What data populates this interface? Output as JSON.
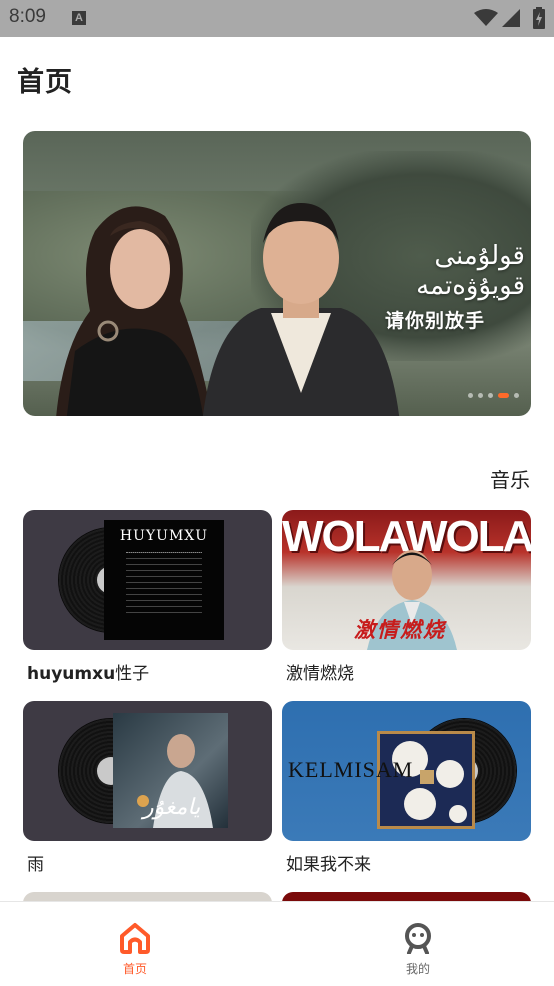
{
  "status_bar": {
    "time": "8:09",
    "notification_icon": "A"
  },
  "header": {
    "title": "首页"
  },
  "banner": {
    "uyghur_text": "قولۇمنى قويۇۋەتمە",
    "cn_text": "请你别放手",
    "dot_count": 5,
    "active_dot_index": 3
  },
  "music_section": {
    "title": "音乐",
    "items": [
      {
        "title_bold": "huyumxu",
        "title_rest": "性子",
        "cover_text": "HUYUMXU"
      },
      {
        "title": "激情燃烧",
        "cover_text": "WOLAWOLA",
        "cover_subtext": "激情燃烧"
      },
      {
        "title": "雨",
        "cover_text": "يامغۇر"
      },
      {
        "title": "如果我不来",
        "cover_text": "KELMISAM"
      }
    ]
  },
  "bottom_nav": {
    "items": [
      {
        "label": "首页",
        "icon": "home-icon",
        "active": true
      },
      {
        "label": "我的",
        "icon": "profile-icon",
        "active": false
      }
    ]
  },
  "colors": {
    "accent": "#ff5a2a",
    "status_bar": "#a9a9a9"
  }
}
